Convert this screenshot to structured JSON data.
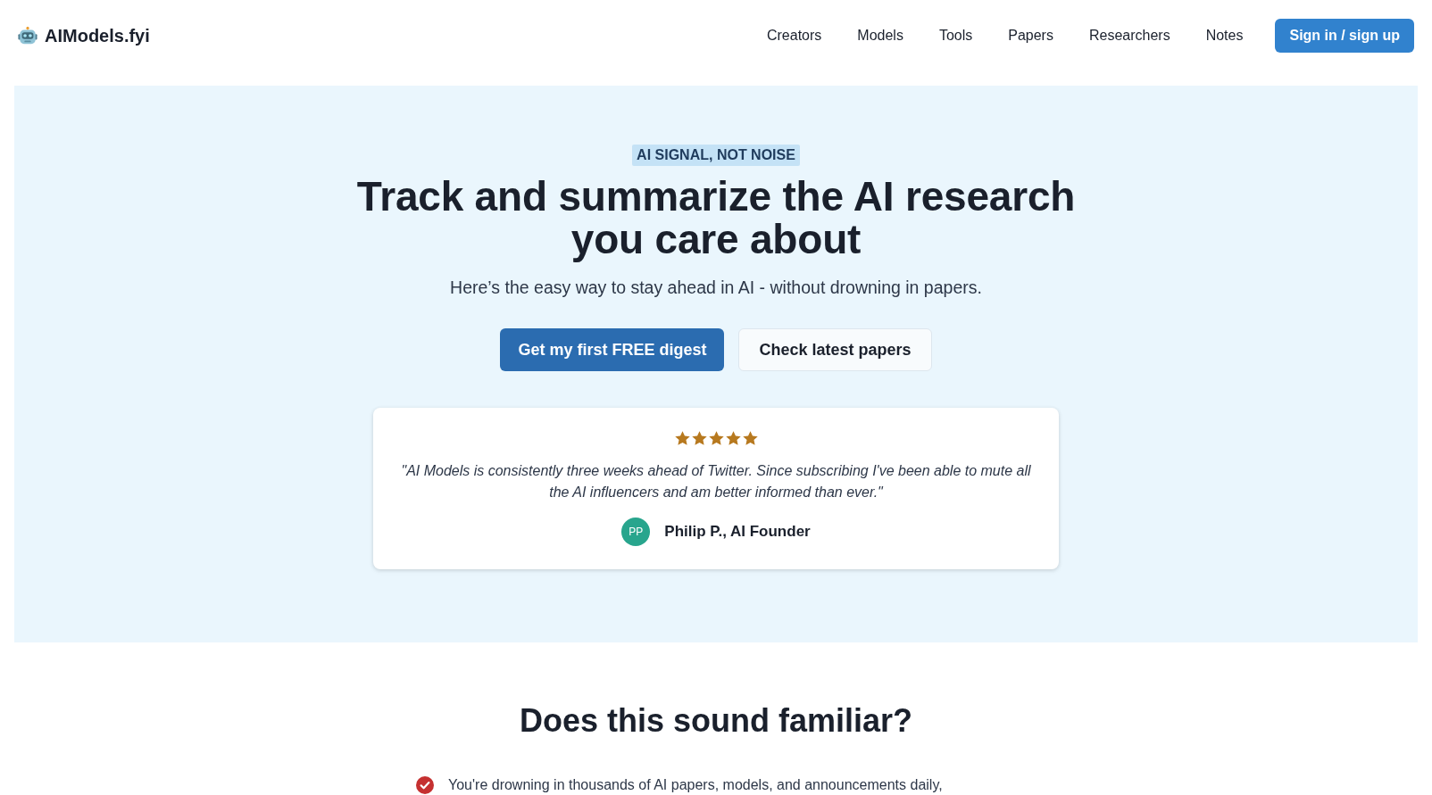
{
  "brand": {
    "name": "AIModels.fyi"
  },
  "nav": {
    "links": [
      "Creators",
      "Models",
      "Tools",
      "Papers",
      "Researchers",
      "Notes"
    ],
    "sign_in": "Sign in / sign up"
  },
  "hero": {
    "eyebrow": "AI SIGNAL, NOT NOISE",
    "title": "Track and summarize the AI research you care about",
    "subtitle": "Here’s the easy way to stay ahead in AI - without drowning in papers.",
    "primary_button": "Get my first FREE digest",
    "secondary_button": "Check latest papers",
    "testimonial": {
      "stars": 5,
      "quote": "\"AI Models is consistently three weeks ahead of Twitter. Since subscribing I've been able to mute all the AI influencers and am better informed than ever.\"",
      "initials": "PP",
      "author": "Philip P., AI Founder"
    }
  },
  "familiar": {
    "title": "Does this sound familiar?",
    "items": [
      "You're drowning in thousands of AI papers, models, and announcements daily,"
    ]
  }
}
